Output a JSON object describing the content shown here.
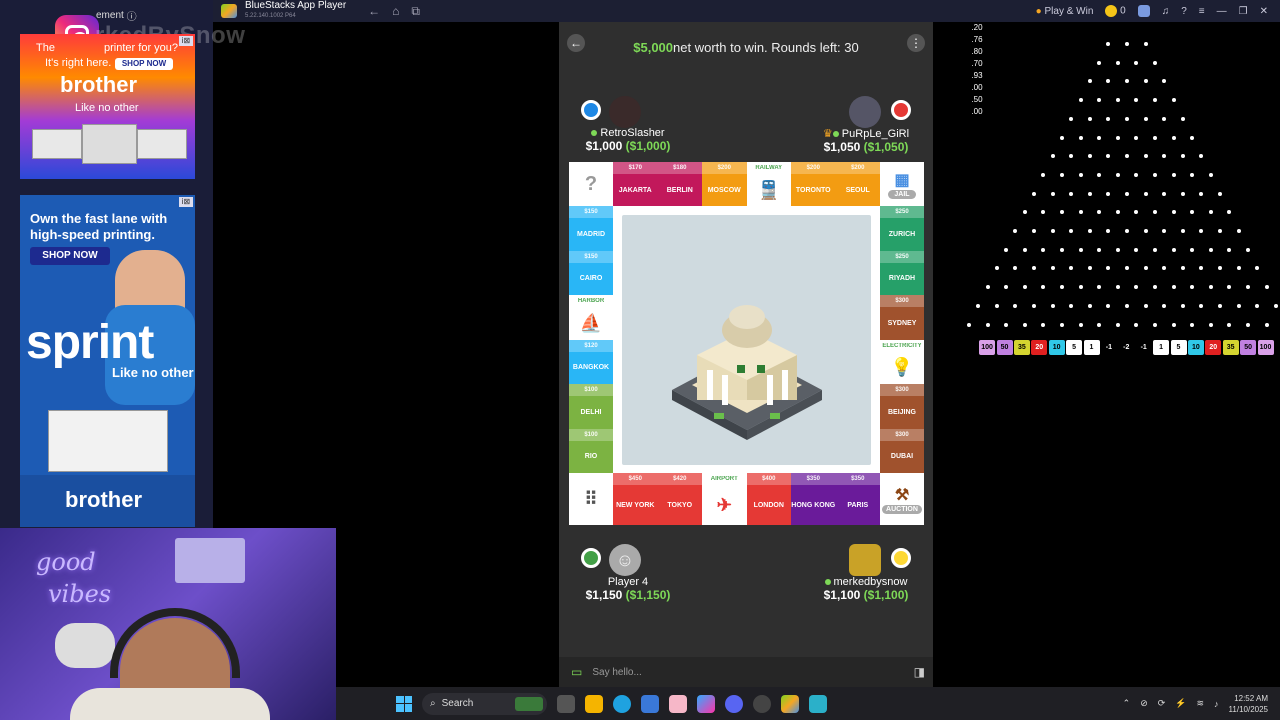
{
  "left_ads": {
    "header_text": "ement",
    "watermark": "rkedBySnow",
    "ad1": {
      "line1": "The",
      "line1b": "printer for you?",
      "line2": "It's right here.",
      "cta": "SHOP NOW",
      "brand": "brother",
      "tagline": "Like no other"
    },
    "ad2": {
      "headline1": "Own the fast lane with",
      "headline2": "high-speed printing.",
      "cta": "SHOP NOW",
      "big": "sprint",
      "tagline": "Like no other",
      "brand": "brother"
    }
  },
  "webcam": {
    "neon1": "good",
    "neon2": "vibes"
  },
  "bluestacks": {
    "title": "BlueStacks App Player",
    "version": "5.22.140.1002 P64",
    "play_win": "Play & Win",
    "coins": "0"
  },
  "game": {
    "goal_amount": "$5,000",
    "goal_text": " net worth to win. Rounds left: 30",
    "players": [
      {
        "name": "RetroSlasher",
        "cash": "$1,000",
        "net": "($1,000)",
        "color": "#1e88e5"
      },
      {
        "name": "PuRpLe_GiRl",
        "cash": "$1,050",
        "net": "($1,050)",
        "color": "#e53935"
      },
      {
        "name": "Player 4",
        "cash": "$1,150",
        "net": "($1,150)",
        "color": "#43a047"
      },
      {
        "name": "merkedbysnow",
        "cash": "$1,100",
        "net": "($1,100)",
        "color": "#fdd835"
      }
    ],
    "top_row": [
      {
        "price": "$170",
        "name": "JAKARTA",
        "color": "#c2185b"
      },
      {
        "price": "$180",
        "name": "BERLIN",
        "color": "#c2185b"
      },
      {
        "price": "$200",
        "name": "MOSCOW",
        "color": "#f39c12"
      },
      {
        "price": "RAILWAY",
        "name": "",
        "color": "#ffffff"
      },
      {
        "price": "$200",
        "name": "TORONTO",
        "color": "#f39c12"
      },
      {
        "price": "$200",
        "name": "SEOUL",
        "color": "#f39c12"
      }
    ],
    "left_col": [
      {
        "price": "$150",
        "name": "MADRID",
        "color": "#29b6f6"
      },
      {
        "price": "$150",
        "name": "CAIRO",
        "color": "#29b6f6"
      },
      {
        "price": "HARBOR",
        "name": "",
        "color": "#ffffff"
      },
      {
        "price": "$120",
        "name": "BANGKOK",
        "color": "#29b6f6"
      },
      {
        "price": "$100",
        "name": "DELHI",
        "color": "#7cb342"
      },
      {
        "price": "$100",
        "name": "RIO",
        "color": "#7cb342"
      }
    ],
    "right_col": [
      {
        "price": "$250",
        "name": "ZURICH",
        "color": "#26a069"
      },
      {
        "price": "$250",
        "name": "RIYADH",
        "color": "#26a069"
      },
      {
        "price": "$300",
        "name": "SYDNEY",
        "color": "#a0522d"
      },
      {
        "price": "ELECTRICITY",
        "name": "",
        "color": "#ffffff"
      },
      {
        "price": "$300",
        "name": "BEIJING",
        "color": "#a0522d"
      },
      {
        "price": "$300",
        "name": "DUBAI",
        "color": "#a0522d"
      }
    ],
    "bottom_row": [
      {
        "price": "$450",
        "name": "NEW YORK",
        "color": "#e53935"
      },
      {
        "price": "$420",
        "name": "TOKYO",
        "color": "#e53935"
      },
      {
        "price": "AIRPORT",
        "name": "",
        "color": "#ffffff"
      },
      {
        "price": "$400",
        "name": "LONDON",
        "color": "#e53935"
      },
      {
        "price": "$350",
        "name": "HONG KONG",
        "color": "#6a1b9a"
      },
      {
        "price": "$350",
        "name": "PARIS",
        "color": "#6a1b9a"
      }
    ],
    "corners": {
      "top_left": "?",
      "top_right": "JAIL",
      "bottom_left": "",
      "bottom_right": "AUCTION"
    },
    "chat_placeholder": "Say hello..."
  },
  "plinko": {
    "side_values": [
      ".20",
      ".76",
      ".80",
      ".70",
      ".93",
      ".00",
      ".50",
      ".00"
    ],
    "buckets": [
      {
        "label": "100",
        "color": "#d9a0e8"
      },
      {
        "label": "50",
        "color": "#c080e0"
      },
      {
        "label": "35",
        "color": "#d4d430"
      },
      {
        "label": "20",
        "color": "#e02020"
      },
      {
        "label": "10",
        "color": "#30c8e8"
      },
      {
        "label": "5",
        "color": "#ffffff"
      },
      {
        "label": "1",
        "color": "#ffffff"
      },
      {
        "label": "-1",
        "color": "#000000"
      },
      {
        "label": "-2",
        "color": "#000000"
      },
      {
        "label": "-1",
        "color": "#000000"
      },
      {
        "label": "1",
        "color": "#ffffff"
      },
      {
        "label": "5",
        "color": "#ffffff"
      },
      {
        "label": "10",
        "color": "#30c8e8"
      },
      {
        "label": "20",
        "color": "#e02020"
      },
      {
        "label": "35",
        "color": "#d4d430"
      },
      {
        "label": "50",
        "color": "#c080e0"
      },
      {
        "label": "100",
        "color": "#d9a0e8"
      }
    ]
  },
  "taskbar": {
    "search": "Search",
    "time": "12:52 AM",
    "date": "11/10/2025"
  }
}
